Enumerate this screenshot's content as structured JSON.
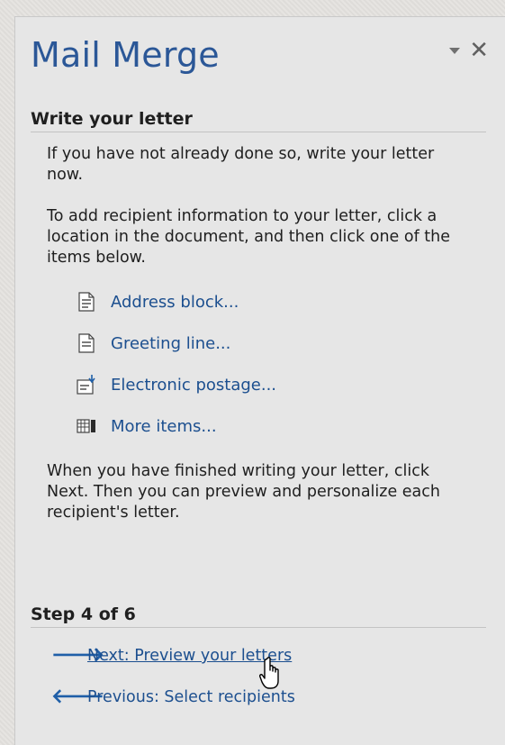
{
  "pane": {
    "title": "Mail Merge"
  },
  "section": {
    "header": "Write your letter",
    "intro": "If you have not already done so, write your letter now.",
    "instructions": "To add recipient information to your letter, click a location in the document, and then click one of the items below.",
    "items": [
      {
        "label": "Address block...",
        "icon": "address-block-icon"
      },
      {
        "label": "Greeting line...",
        "icon": "greeting-line-icon"
      },
      {
        "label": "Electronic postage...",
        "icon": "electronic-postage-icon"
      },
      {
        "label": "More items...",
        "icon": "more-items-icon"
      }
    ],
    "finish_text": "When you have finished writing your letter, click Next. Then you can preview and personalize each recipient's letter."
  },
  "step": {
    "header": "Step 4 of 6",
    "next_label": "Next: Preview your letters",
    "previous_label": "Previous: Select recipients"
  },
  "colors": {
    "title": "#2b5797",
    "link": "#1c4f8f",
    "arrow": "#1f5fa8",
    "pane_bg": "#e6e6e6"
  }
}
